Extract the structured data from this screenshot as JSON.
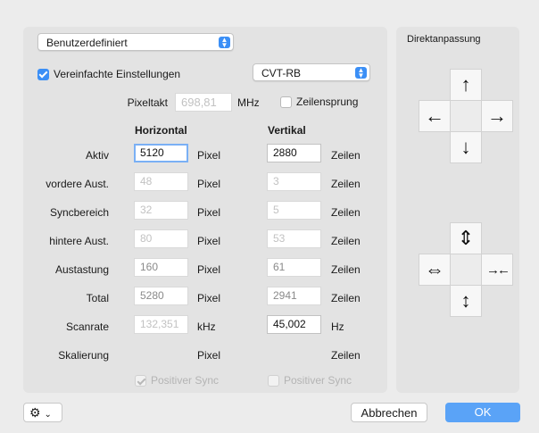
{
  "preset_popup": {
    "value": "Benutzerdefiniert"
  },
  "simplified": {
    "label": "Vereinfachte Einstellungen",
    "checked": true
  },
  "timing_popup": {
    "value": "CVT-RB"
  },
  "pixel_clock": {
    "label": "Pixeltakt",
    "value": "698,81",
    "unit": "MHz"
  },
  "interlace": {
    "label": "Zeilensprung",
    "checked": false
  },
  "columns": {
    "horizontal": "Horizontal",
    "vertical": "Vertikal"
  },
  "rows": [
    {
      "label": "Aktiv",
      "h_value": "5120",
      "h_unit": "Pixel",
      "v_value": "2880",
      "v_unit": "Zeilen"
    },
    {
      "label": "vordere Aust.",
      "h_value": "48",
      "h_unit": "Pixel",
      "v_value": "3",
      "v_unit": "Zeilen"
    },
    {
      "label": "Syncbereich",
      "h_value": "32",
      "h_unit": "Pixel",
      "v_value": "5",
      "v_unit": "Zeilen"
    },
    {
      "label": "hintere Aust.",
      "h_value": "80",
      "h_unit": "Pixel",
      "v_value": "53",
      "v_unit": "Zeilen"
    },
    {
      "label": "Austastung",
      "h_value": "160",
      "h_unit": "Pixel",
      "v_value": "61",
      "v_unit": "Zeilen"
    },
    {
      "label": "Total",
      "h_value": "5280",
      "h_unit": "Pixel",
      "v_value": "2941",
      "v_unit": "Zeilen"
    },
    {
      "label": "Scanrate",
      "h_value": "132,351",
      "h_unit": "kHz",
      "v_value": "45,002",
      "v_unit": "Hz"
    },
    {
      "label": "Skalierung",
      "h_value": "",
      "h_unit": "Pixel",
      "v_value": "",
      "v_unit": "Zeilen"
    }
  ],
  "sync": {
    "h_label": "Positiver Sync",
    "v_label": "Positiver Sync"
  },
  "direct": {
    "title": "Direktanpassung",
    "move_up": "↑",
    "move_left": "←",
    "move_right": "→",
    "move_down": "↓",
    "stretch_v": "⇕",
    "stretch_h": "⇔",
    "shrink_h": "→←",
    "shrink_v": "↕"
  },
  "footer": {
    "gear": "⚙",
    "gear_chevron": "⌄",
    "cancel": "Abbrechen",
    "ok": "OK"
  },
  "colors": {
    "accent": "#3b8ff6",
    "ok_button": "#5aa3f7"
  }
}
